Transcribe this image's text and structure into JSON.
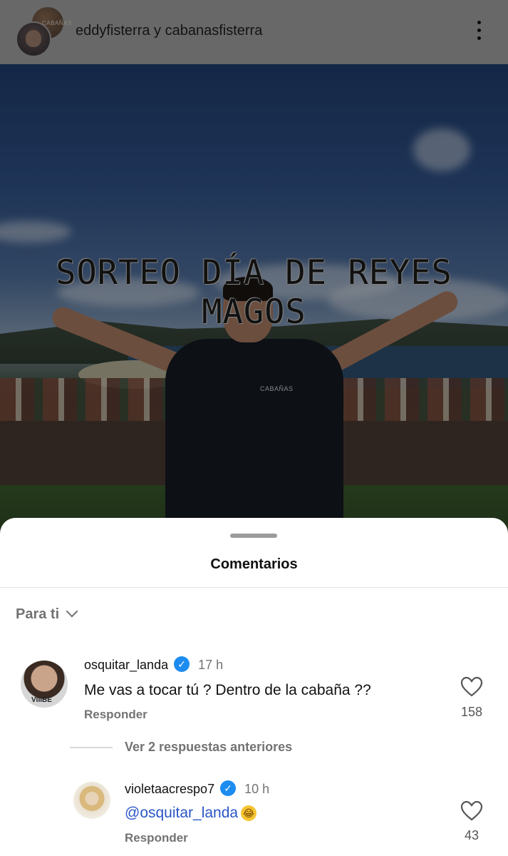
{
  "header": {
    "title": "eddyfisterra y cabanasfisterra",
    "back_avatar_text": "CABAÑAS",
    "more_icon": "more-vertical-icon"
  },
  "post": {
    "title_text": "Sorteo día de Reyes Magos",
    "shirt_logo": "CABAÑAS"
  },
  "comments_sheet": {
    "title": "Comentarios",
    "filter_label": "Para ti",
    "comments": [
      {
        "username": "osquitar_landa",
        "verified": true,
        "time": "17 h",
        "text": "Me vas a tocar tú ? Dentro de la cabaña ??",
        "reply_label": "Responder",
        "likes": "158"
      }
    ],
    "view_replies_label": "Ver 2 respuestas anteriores",
    "replies": [
      {
        "username": "violetaacrespo7",
        "verified": true,
        "time": "10 h",
        "mention": "@osquitar_landa",
        "emoji": "😂",
        "reply_label": "Responder",
        "likes": "43"
      }
    ]
  },
  "colors": {
    "verified": "#1d8cf0",
    "mention": "#2a56c6",
    "secondary_text": "#737373"
  }
}
